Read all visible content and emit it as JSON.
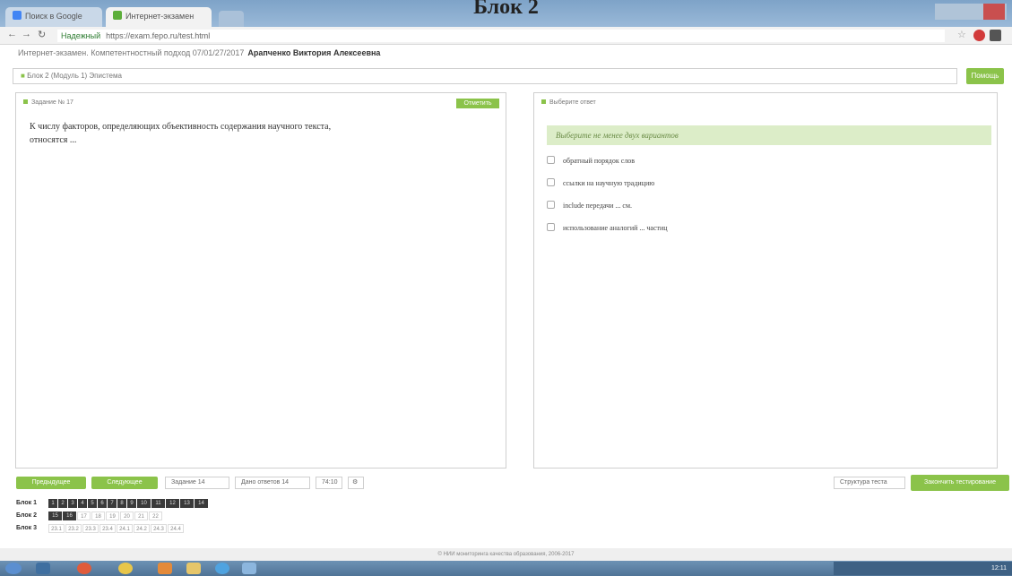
{
  "doc_title": "Блок 2",
  "browser": {
    "tabs": [
      {
        "label": "Поиск в Google"
      },
      {
        "label": "Интернет-экзамен"
      }
    ],
    "security_label": "Надежный",
    "url": "https://exam.fepo.ru/test.html"
  },
  "header": {
    "student_prefix": "Интернет-экзамен. Компетентностный подход 07/01/27/2017",
    "student_name": "Арапченко Виктория Алексеевна",
    "block_label": "Блок 2 (Модуль 1) Эпистема",
    "help_label": "Помощь"
  },
  "question": {
    "title": "Задание № 17",
    "mark_label": "Отметить",
    "text": "К числу факторов, определяющих объективность содержания научного текста, относятся ..."
  },
  "answer": {
    "title": "Выберите ответ",
    "instruction": "Выберите не менее двух вариантов",
    "options": [
      "обратный порядок слов",
      "ссылки на научную традицию",
      "include передачи ... см.",
      "использование аналогий ... частиц"
    ]
  },
  "controls": {
    "prev_label": "Предыдущее",
    "next_label": "Следующее",
    "task_label": "Задание 14",
    "answered_label": "Дано ответов 14",
    "time_label": "74:10",
    "structure_label": "Структура теста",
    "finish_label": "Закончить тестирование"
  },
  "blocks": [
    {
      "label": "Блок 1",
      "cells": [
        "1",
        "2",
        "3",
        "4",
        "5",
        "6",
        "7",
        "8",
        "9",
        "10",
        "11",
        "12",
        "13",
        "14"
      ]
    },
    {
      "label": "Блок 2",
      "cells": [
        "15",
        "16",
        "17",
        "18",
        "19",
        "20",
        "21",
        "22"
      ]
    },
    {
      "label": "Блок 3",
      "cells": [
        "23.1",
        "23.2",
        "23.3",
        "23.4",
        "24.1",
        "24.2",
        "24.3",
        "24.4"
      ]
    }
  ],
  "footer": "© НИИ мониторинга качества образования, 2006-2017",
  "tray_time": "12:11"
}
